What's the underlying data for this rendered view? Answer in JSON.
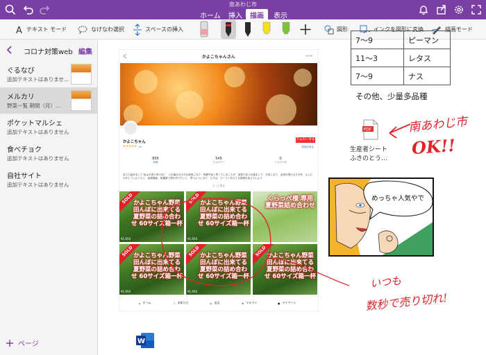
{
  "window": {
    "title": "南あわじ市"
  },
  "ribbon": {
    "tabs": [
      {
        "label": "ホーム"
      },
      {
        "label": "挿入"
      },
      {
        "label": "描画"
      },
      {
        "label": "表示"
      }
    ],
    "active_tab": "描画"
  },
  "toolbar": {
    "text_mode": "テキスト モード",
    "lasso_select": "なげなわ選択",
    "insert_space": "スペースの挿入",
    "shapes": "図形",
    "ink_to_shape": "インクを図形に変換",
    "drawing_mode": "描画モード",
    "pen_colors": [
      "#f0a0a8",
      "#2a2a2a",
      "#2a2a2a",
      "#f5e11a",
      "#7ec13a"
    ]
  },
  "sidebar": {
    "section_title": "コロナ対策web",
    "edit_label": "編集",
    "pages": [
      {
        "title": "ぐるなび",
        "subtitle": "追加テキストはありませ…"
      },
      {
        "title": "メルカリ",
        "subtitle": "野菜一覧 期間（月）…"
      },
      {
        "title": "ポケットマルシェ",
        "subtitle": "追加テキストはありません"
      },
      {
        "title": "食べチョク",
        "subtitle": "追加テキストはありません"
      },
      {
        "title": "自社サイト",
        "subtitle": "追加テキストはありません"
      }
    ],
    "add_page_label": "ページ"
  },
  "mercari": {
    "header_title": "かよこちゃんさん",
    "profile_name": "かよこちゃん",
    "stars": "★★★★★",
    "rating_count": "00",
    "follow_label": "フォローする",
    "report_label": "評価を見る",
    "stats": [
      {
        "value": "896",
        "label": "評価"
      },
      {
        "value": "548",
        "label": "フォロワー"
      },
      {
        "value": "0",
        "label": "フォロー中"
      }
    ],
    "description": "あさん始めまして 私は平成19年3月に　人生最大の大きな病気になり　両親不幸と思っていましたが　家族や友人の励ましで　元気になり　自然の物わならがを　よいにかがしていようらに　祖健康菜、無農薬で物を作りたいと　思うようになり　だすは　ピーマンを日さる感謝を迎えていよう",
    "more_label": "もっと見る",
    "items": [
      {
        "sold": "SOLD",
        "caption": "かよこちゃん野菜 田んぼに出来てる 夏野菜の詰め合わせ 60サイズ箱一杯",
        "price": "¥1,650"
      },
      {
        "sold": "SOLD",
        "caption": "かよこちゃん野菜 田んぼに出来てる 夏野菜の詰め合わせ 60サイズ箱一杯",
        "price": "¥1,650"
      },
      {
        "sold": "",
        "caption": "くらっぺ様 専用 夏野菜詰め合わせ",
        "price": ""
      },
      {
        "sold": "SOLD",
        "caption": "かよこちゃん野菜 田んぼに出来てる 夏野菜の詰め合わせ 60サイズ箱一杯",
        "price": "¥1,650"
      },
      {
        "sold": "SOLD",
        "caption": "かよこちゃん野菜 田んぼに出来てる 夏野菜の詰め合わせ 60サイズ箱一杯",
        "price": "¥1,650"
      },
      {
        "sold": "SOLD",
        "caption": "かよこちゃん野菜 田んぼに出来てる 夏野菜の詰め合わせ 60サイズ箱一杯",
        "price": ""
      }
    ],
    "nav": [
      {
        "label": "ホーム",
        "icon": "home-icon"
      },
      {
        "label": "お知らせ",
        "icon": "bell-icon"
      },
      {
        "label": "出品",
        "icon": "camera-icon"
      },
      {
        "label": "メルペイ",
        "icon": "pay-icon"
      },
      {
        "label": "マイページ",
        "icon": "person-icon"
      }
    ]
  },
  "notes": {
    "table": [
      [
        "7～9",
        "ピーマン"
      ],
      [
        "11～3",
        "レタス"
      ],
      [
        "7～9",
        "ナス"
      ]
    ],
    "other_text": "その他、少量多品種",
    "file_name_line1": "生産者シート",
    "file_name_line2": "ふきのとう…",
    "comic_bubble": "めっちゃ人気やで",
    "ink_city": "南あわじ市",
    "ink_ok": "OK!!",
    "ink_line1": "いつも",
    "ink_line2": "数秒で売り切れ!"
  }
}
